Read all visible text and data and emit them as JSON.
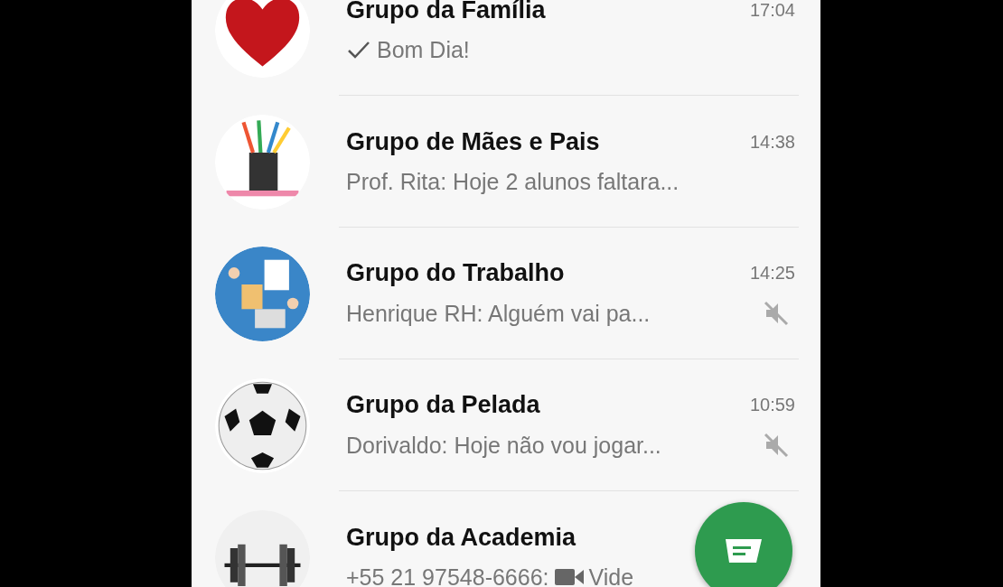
{
  "chats": [
    {
      "name": "Grupo da Família",
      "time": "17:04",
      "sent": true,
      "muted": false,
      "avatar": {
        "kind": "heart"
      },
      "preview": [
        {
          "kind": "text",
          "text": "Bom Dia!"
        }
      ]
    },
    {
      "name": "Grupo de Mães e Pais",
      "time": "14:38",
      "sent": false,
      "muted": false,
      "avatar": {
        "kind": "pencils"
      },
      "preview": [
        {
          "kind": "text",
          "text": "Prof. Rita: Hoje 2 alunos faltara..."
        }
      ]
    },
    {
      "name": "Grupo do Trabalho",
      "time": "14:25",
      "sent": false,
      "muted": true,
      "avatar": {
        "kind": "desk"
      },
      "preview": [
        {
          "kind": "text",
          "text": "Henrique RH: Alguém vai pa..."
        }
      ]
    },
    {
      "name": "Grupo da Pelada",
      "time": "10:59",
      "sent": false,
      "muted": true,
      "avatar": {
        "kind": "ball"
      },
      "preview": [
        {
          "kind": "text",
          "text": "Dorivaldo: Hoje não vou jogar..."
        }
      ]
    },
    {
      "name": "Grupo da Academia",
      "sent": false,
      "muted": false,
      "avatar": {
        "kind": "dumbbell"
      },
      "preview": [
        {
          "kind": "text",
          "text": "+55 21 97548-6666:"
        },
        {
          "kind": "video"
        },
        {
          "kind": "text",
          "text": "Vide"
        }
      ]
    }
  ]
}
